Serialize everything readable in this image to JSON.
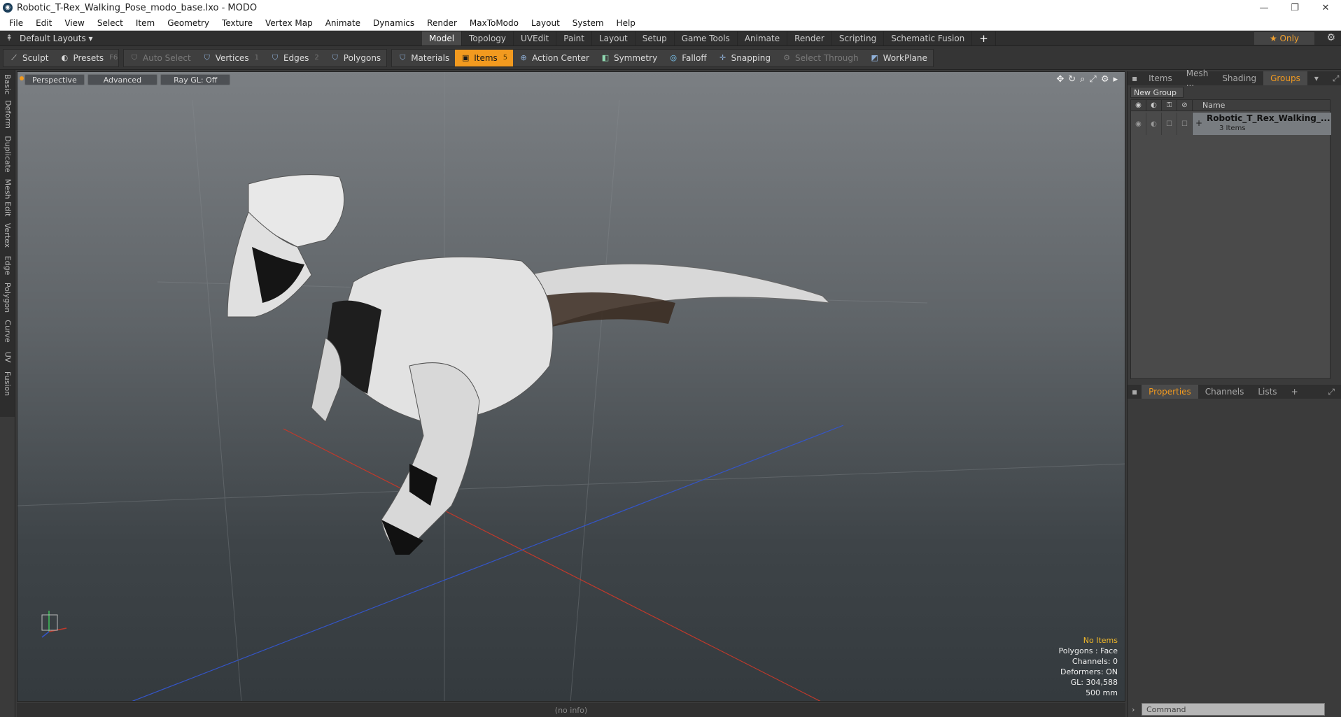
{
  "window": {
    "title": "Robotic_T-Rex_Walking_Pose_modo_base.lxo - MODO",
    "controls": [
      "—",
      "❐",
      "✕"
    ]
  },
  "menu": [
    "File",
    "Edit",
    "View",
    "Select",
    "Item",
    "Geometry",
    "Texture",
    "Vertex Map",
    "Animate",
    "Dynamics",
    "Render",
    "MaxToModo",
    "Layout",
    "System",
    "Help"
  ],
  "layoutbar": {
    "layout_select": "Default Layouts ▾",
    "tabs": [
      "Model",
      "Topology",
      "UVEdit",
      "Paint",
      "Layout",
      "Setup",
      "Game Tools",
      "Animate",
      "Render",
      "Scripting",
      "Schematic Fusion",
      "+"
    ],
    "active_tab": "Model",
    "only_label": "★  Only"
  },
  "toolbar": {
    "sculpt": "Sculpt",
    "presets": "Presets",
    "presets_key": "F6",
    "auto_select": "Auto Select",
    "vertices": "Vertices",
    "vertices_key": "1",
    "edges": "Edges",
    "edges_key": "2",
    "polygons": "Polygons",
    "materials": "Materials",
    "items": "Items",
    "items_key": "5",
    "action_center": "Action Center",
    "symmetry": "Symmetry",
    "falloff": "Falloff",
    "snapping": "Snapping",
    "select_through": "Select Through",
    "workplane": "WorkPlane"
  },
  "left_tabs": [
    "Basic",
    "Deform",
    "Duplicate",
    "Mesh Edit",
    "Vertex",
    "Edge",
    "Polygon",
    "Curve",
    "UV",
    "Fusion"
  ],
  "viewport": {
    "view_mode": "Perspective",
    "shading": "Advanced",
    "raygl": "Ray GL: Off",
    "info": {
      "selection": "No Items",
      "polygons": "Polygons : Face",
      "channels": "Channels: 0",
      "deformers": "Deformers: ON",
      "gl": "GL: 304,588",
      "scale": "500 mm"
    }
  },
  "status": "(no info)",
  "right_panel": {
    "tabs": [
      "Items",
      "Mesh ...",
      "Shading",
      "Groups"
    ],
    "active_tab": "Groups",
    "new_group": "New Group",
    "column_name": "Name",
    "group": {
      "name": "Robotic_T_Rex_Walking_...",
      "count": "3 Items"
    },
    "lower_tabs": [
      "Properties",
      "Channels",
      "Lists",
      "+"
    ],
    "lower_active": "Properties",
    "command_placeholder": "Command"
  }
}
